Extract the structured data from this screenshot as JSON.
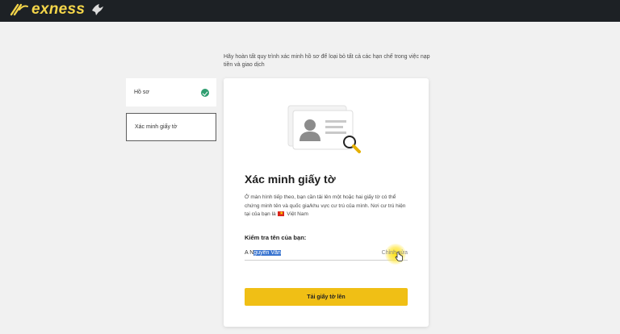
{
  "header": {
    "logo_text": "exness",
    "brand_color": "#f5d64a",
    "background": "#1d2125"
  },
  "intro": {
    "text": "Hãy hoàn tất quy trình xác minh hồ sơ để loại bỏ tất cả các hạn chế trong việc nạp tiền và giao dịch"
  },
  "sidebar": {
    "items": [
      {
        "label": "Hồ sơ",
        "status": "completed"
      },
      {
        "label": "Xác minh giấy tờ",
        "status": "active"
      }
    ]
  },
  "card": {
    "title": "Xác minh giấy tờ",
    "description": "Ở màn hình tiếp theo, bạn cần tải lên một hoặc hai giấy tờ có thể chứng minh tên và quốc gia/khu vực cư trú của mình. Nơi cư trú hiện tại của bạn là",
    "country": "Việt Nam",
    "check_name_label": "Kiểm tra tên của bạn:",
    "name_prefix": "A N",
    "name_selected": "guyễn Văn",
    "edit_label": "Chỉnh sửa",
    "upload_button": "Tải giấy tờ lên",
    "accent_color": "#f0bf15"
  }
}
